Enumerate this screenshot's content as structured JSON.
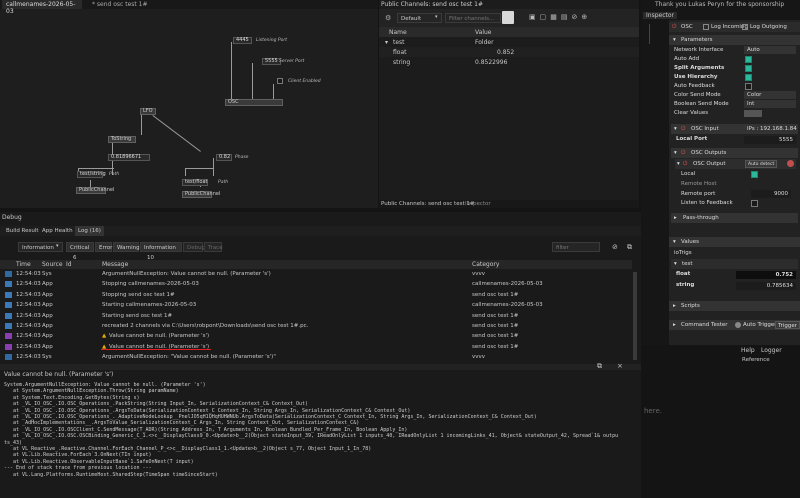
{
  "editor": {
    "tabs": [
      "callmenames-2026-05-03",
      "* send osc test 1#"
    ],
    "nodes": {
      "port": "4445",
      "server_port": "5555",
      "osc": "OSC",
      "lfo": "LFO",
      "tostring": "ToString",
      "val1": "0.81896671",
      "val2": "0.82",
      "text_string": "test/string",
      "text_float": "test/float",
      "pubch": "PublicChannel",
      "pubch2": "PublicChannel"
    },
    "labels": {
      "listening": "Listening Port",
      "server": "Server Port",
      "client": "Client Enabled",
      "path1": "Path",
      "path2": "Path",
      "phase": "Phase"
    }
  },
  "channels": {
    "title": "Public Channels: send osc test 1#",
    "default": "Default",
    "filter_placeholder": "Filter channels...",
    "col_name": "Name",
    "col_value": "Value",
    "rows": [
      {
        "name": "test",
        "value": "Folder"
      },
      {
        "name": "float",
        "value": "0.852"
      },
      {
        "name": "string",
        "value": "0.8522996"
      }
    ],
    "footer_tab1": "Public Channels: send osc test 1#",
    "footer_tab2": "Inspector"
  },
  "inspector": {
    "title": "Inspector",
    "sponsor": "Thank you Lukas Peryn for the sponsorship",
    "osc": "OSC",
    "log_incoming": "Log Incoming",
    "log_outgoing": "Log Outgoing",
    "parameters": "Parameters",
    "network_interface": "Network Interface",
    "network_value": "Auto",
    "auto_add": "Auto Add",
    "split_arguments": "Split Arguments",
    "use_hierarchy": "Use Hierarchy",
    "auto_feedback": "Auto Feedback",
    "color_send_mode": "Color Send Mode",
    "color_value": "Color",
    "boolean_send_mode": "Boolean Send Mode",
    "bool_value": "Int",
    "clear_values": "Clear Values",
    "osc_input": "OSC Input",
    "ips": "IPs : 192.168.1.84",
    "local_port": "Local Port",
    "local_port_value": "5555",
    "osc_outputs": "OSC Outputs",
    "osc_output": "OSC Output",
    "auto_detect": "Auto detect",
    "local": "Local",
    "remote_host": "Remote Host",
    "remote_port": "Remote port",
    "remote_port_value": "9000",
    "listen_feedback": "Listen to Feedback",
    "pass_through": "Pass-through",
    "values": "Values",
    "io_trigs": "ioTrigs",
    "test": "test",
    "float": "float",
    "float_value": "0.752",
    "string": "string",
    "string_value": "0.785634",
    "scripts": "Scripts",
    "command_tester": "Command Tester",
    "auto_trigger": "Auto Trigger",
    "trigger": "Trigger",
    "help": "Help",
    "logger": "Logger",
    "reference": "Reference",
    "here": "here."
  },
  "debug": {
    "title": "Debug",
    "tabs": [
      "Build Result",
      "App Health",
      "Log (16)"
    ],
    "level": "Information",
    "critical": "Critical",
    "critical_count": "6",
    "error": "Error",
    "warning": "Warning",
    "information": "Information",
    "info_count": "10",
    "debug_btn": "Debug",
    "trace_btn": "Trace",
    "filter_placeholder": "filter",
    "cols": [
      "Time",
      "Source",
      "Id",
      "Message",
      "Category"
    ],
    "rows": [
      {
        "time": "12:54:03",
        "source": "Sys",
        "msg": "ArgumentNullException: Value cannot be null. (Parameter 's')",
        "cat": "vvvv",
        "kind": "sys"
      },
      {
        "time": "12:54:03",
        "source": "App",
        "msg": "Stopping callmenames-2026-05-03",
        "cat": "callmenames-2026-05-03",
        "kind": "app"
      },
      {
        "time": "12:54:03",
        "source": "App",
        "msg": "Stopping send osc test 1#",
        "cat": "send osc test 1#",
        "kind": "app"
      },
      {
        "time": "12:54:03",
        "source": "App",
        "msg": "Starting callmenames-2026-05-03",
        "cat": "callmenames-2026-05-03",
        "kind": "app"
      },
      {
        "time": "12:54:03",
        "source": "App",
        "msg": "Starting send osc test 1#",
        "cat": "send osc test 1#",
        "kind": "app"
      },
      {
        "time": "12:54:03",
        "source": "App",
        "msg": "recreated 2 channels via C:\\Users\\robpont\\Downloads\\send osc test 1#.pc.",
        "cat": "send osc test 1#",
        "kind": "app"
      },
      {
        "time": "12:54:03",
        "source": "App",
        "msg": "Value cannot be null. (Parameter 's')",
        "cat": "send osc test 1#",
        "kind": "warn"
      },
      {
        "time": "12:54:03",
        "source": "App",
        "msg": "Value cannot be null. (Parameter 's')",
        "cat": "send osc test 1#",
        "kind": "warn"
      },
      {
        "time": "12:54:03",
        "source": "Sys",
        "msg": "ArgumentNullException: \"Value cannot be null. (Parameter 's')\"",
        "cat": "vvvv",
        "kind": "sys"
      }
    ],
    "detail_title": "Value cannot be null. (Parameter 's')",
    "trace": "System.ArgumentNullException: Value cannot be null. (Parameter 's')\n   at System.ArgumentNullException.Throw(String paramName)\n   at System.Text.Encoding.GetBytes(String s)\n   at _VL_IO_OSC_.IO.OSC_Operations_.PackString(String Input_In, SerializationContext_C& Context_Out)\n   at _VL_IO_OSC_.IO.OSC_Operations_.ArgsToData(SerializationContext_C Context_In, String Args_In, SerializationContext_C& Context_Out)\n   at _VL_IO_OSC_.IO.OSC_Operations_._AdaptiveNodeLookup__PnelJO5qH1QHqHUHWNUb.ArgsToData(SerializationContext_C Context_In, String Args_In, SerializationContext_C& Context_Out)\n   at _AdHocImplementations__.ArgsToValue_SerializationContext_C Args_In, String Context_Out, SerializationContext_C&)\n   at _VL_IO_OSC_.IO.OSCClient_C.SendMessage(T_ADR)(String Address_In, T Arguments_In, Boolean Bundled_Per_Frame_In, Boolean Apply_In)\n   at _VL_IO_OSC_.IO.OSC.OSCBinding_Generic_C_1.<>c__DisplayClass9_0.<Update>b__2(Object stateInput_39, IReadOnlyList 1 inputs_40, IReadOnlyList 1 incomingLinks_41, Object& stateOutput_42, Spread`1& outpu\nts_43)\n   at VL_Reactive_.Reactive.Channel.ForEach_Channel_P_<>c__DisplayClass1_1.<Update>b__2(Object s_77, Object Input_1_In_78)\n   at VL.Lib.Reactive.ForEach`3.OnNext(TIn input)\n   at VL.Lib.Reactive.ObservableInputBase`1.SafeOnNext(T input)\n--- End of stack trace from previous location ---\n   at VL.Lang.Platforms.RuntimeHost.SharedStep(TimeSpan timeSinceStart)"
  }
}
